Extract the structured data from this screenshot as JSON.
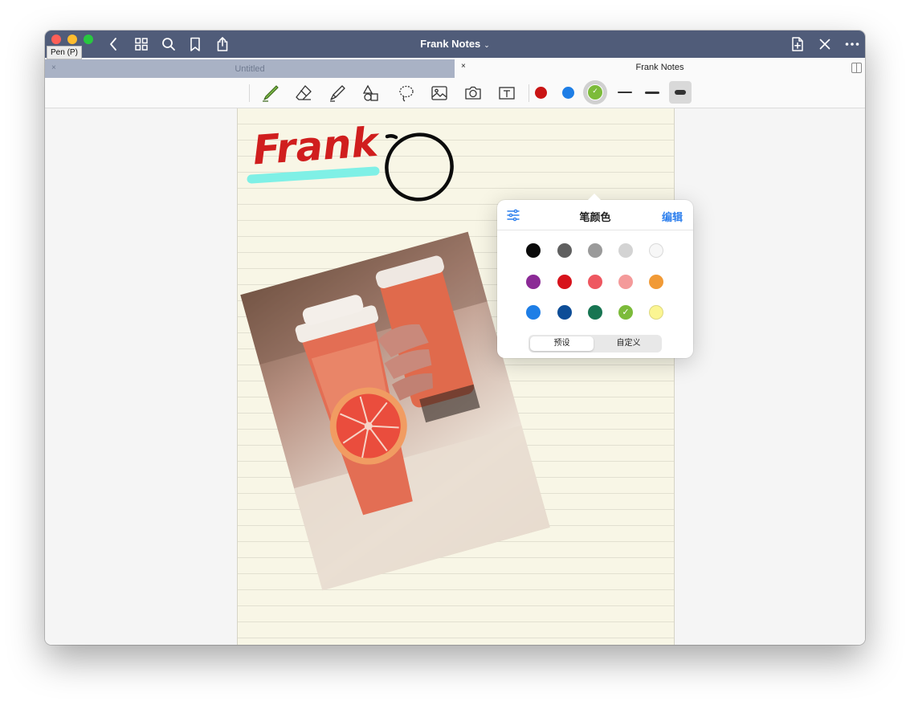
{
  "window": {
    "title": "Frank Notes",
    "title_chevron": "⌄",
    "tooltip": "Pen (P)"
  },
  "tabs": [
    {
      "title": "Untitled",
      "close": "×"
    },
    {
      "title": "Frank Notes",
      "close": "×"
    }
  ],
  "toolbar": {
    "colors": [
      "#c91414",
      "#1e7ee6",
      "#7cbb3a"
    ]
  },
  "note": {
    "handwriting": "Frank",
    "ink_color": "#d01e1e",
    "highlight_color": "#7ff0e6"
  },
  "popover": {
    "title": "笔颜色",
    "edit": "编辑",
    "palette": [
      [
        "#0a0a0a",
        "#5f5f5f",
        "#9a9a9a",
        "#d3d3d3",
        "#f7f7f7"
      ],
      [
        "#8b2a96",
        "#d7121b",
        "#ee5760",
        "#f49a9a",
        "#f19a36"
      ],
      [
        "#1e7ee6",
        "#0d4d97",
        "#187552",
        "#7cbb3a",
        "#fbf592"
      ]
    ],
    "checkmark": "✓",
    "segments": [
      "预设",
      "自定义"
    ]
  }
}
